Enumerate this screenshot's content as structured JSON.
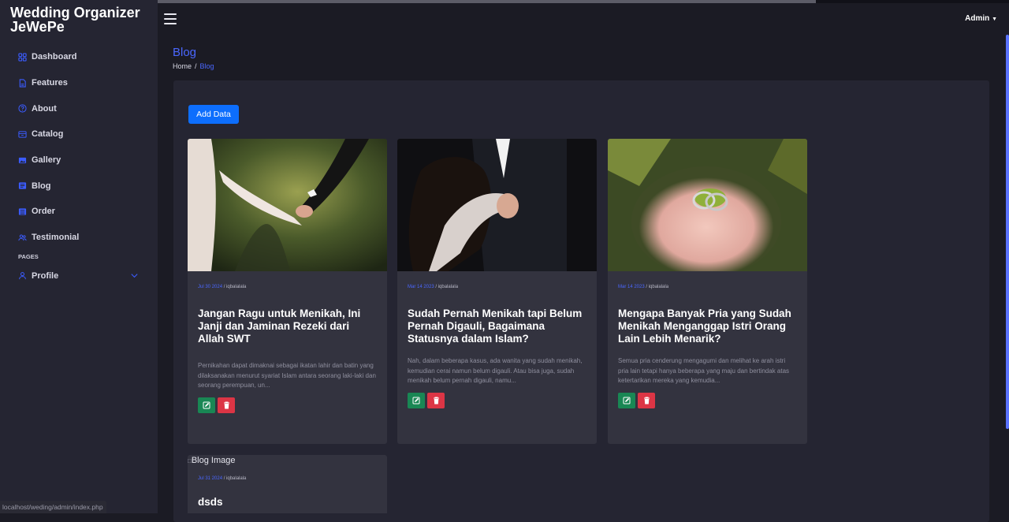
{
  "brand": {
    "line1": "Wedding Organizer",
    "line2": "JeWePe"
  },
  "sidebar": {
    "items": [
      {
        "label": "Dashboard",
        "icon": "grid-icon"
      },
      {
        "label": "Features",
        "icon": "document-icon"
      },
      {
        "label": "About",
        "icon": "question-circle-icon"
      },
      {
        "label": "Catalog",
        "icon": "archive-icon"
      },
      {
        "label": "Gallery",
        "icon": "image-icon"
      },
      {
        "label": "Blog",
        "icon": "newspaper-icon"
      },
      {
        "label": "Order",
        "icon": "receipt-icon"
      },
      {
        "label": "Testimonial",
        "icon": "people-icon"
      }
    ],
    "pages_heading": "PAGES",
    "profile_label": "Profile"
  },
  "header": {
    "admin_label": "Admin"
  },
  "page": {
    "title": "Blog",
    "breadcrumb_home": "Home",
    "breadcrumb_sep": "/",
    "breadcrumb_current": "Blog"
  },
  "add_button": "Add Data",
  "cards": [
    {
      "date": "Jul 30 2024",
      "author": "/ iqbalalala",
      "title": "Jangan Ragu untuk Menikah, Ini Janji dan Jaminan Rezeki dari Allah SWT",
      "excerpt": "Pernikahan dapat dimaknai sebagai ikatan lahir dan batin yang dilaksanakan menurut syariat Islam antara seorang laki-laki dan seorang perempuan, un..."
    },
    {
      "date": "Mar 14 2023",
      "author": "/ iqbalalala",
      "title": "Sudah Pernah Menikah tapi Belum Pernah Digauli, Bagaimana Statusnya dalam Islam?",
      "excerpt": "Nah, dalam beberapa kasus, ada wanita yang sudah menikah, kemudian cerai namun belum digauli. Atau bisa juga, sudah menikah belum pernah digauli, namu..."
    },
    {
      "date": "Mar 14 2023",
      "author": "/ iqbalalala",
      "title": "Mengapa Banyak Pria yang Sudah Menikah Menganggap Istri Orang Lain Lebih Menarik?",
      "excerpt": "Semua pria cenderung mengagumi dan melihat ke arah istri pria lain tetapi hanya beberapa yang maju dan bertindak atas ketertarikan mereka yang kemudia..."
    },
    {
      "image_alt": "Blog Image",
      "date": "Jul 31 2024",
      "author": "/ iqbalalala",
      "title": "dsds"
    }
  ],
  "status_url": "localhost/weding/admin/index.php",
  "colors": {
    "accent": "#4a67ff",
    "edit": "#198754",
    "delete": "#dc3545",
    "primary": "#0d6efd"
  }
}
